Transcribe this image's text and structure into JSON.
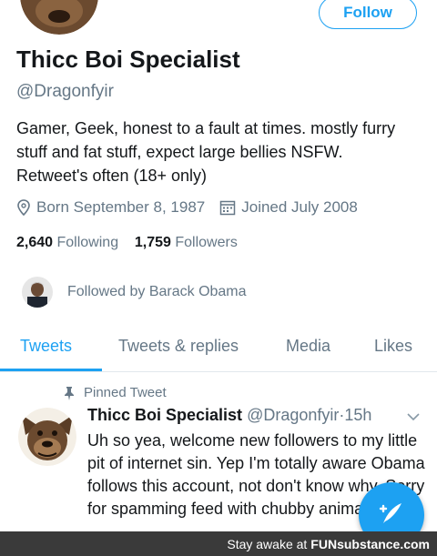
{
  "profile": {
    "follow_label": "Follow",
    "name": "Thicc Boi Specialist",
    "handle": "@Dragonfyir",
    "bio": "Gamer, Geek, honest to a fault at times. mostly furry stuff and fat stuff, expect large bellies NSFW. Retweet's often (18+ only)",
    "born": "Born September 8, 1987",
    "joined": "Joined July 2008",
    "following_count": "2,640",
    "following_label": "Following",
    "followers_count": "1,759",
    "followers_label": "Followers",
    "followed_by": "Followed by Barack Obama"
  },
  "tabs": [
    {
      "label": "Tweets"
    },
    {
      "label": "Tweets & replies"
    },
    {
      "label": "Media"
    },
    {
      "label": "Likes"
    }
  ],
  "tweet": {
    "pinned_label": "Pinned Tweet",
    "author_name": "Thicc Boi Specialist",
    "author_handle": "@Dragonfyir",
    "separator": "·",
    "time": "15h",
    "text": "Uh so yea, welcome new followers to my little pit of internet sin. Yep I'm totally aware Obama follows this account, not don't know why. Sorry for spamming feed with chubby animal people"
  },
  "footer": {
    "text": "Stay awake at",
    "brand": "FUNsubstance.com"
  },
  "colors": {
    "accent": "#1da1f2",
    "muted": "#657786",
    "text": "#14171a"
  },
  "icons": [
    "location-icon",
    "calendar-icon",
    "pin-icon",
    "chevron-down-icon",
    "compose-icon"
  ]
}
